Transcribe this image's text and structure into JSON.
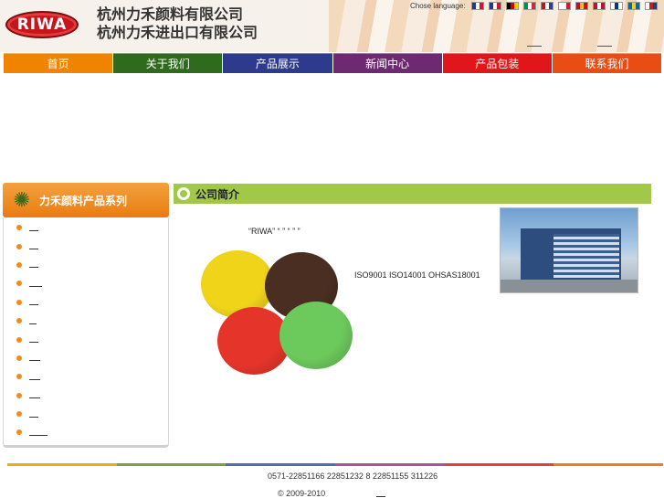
{
  "header": {
    "logo_text": "RIWA",
    "company_line1": "杭州力禾颜料有限公司",
    "company_line2": "杭州力禾进出口有限公司",
    "language_label": "Chose language:",
    "flags": [
      {
        "name": "uk-flag-icon",
        "colors": [
          "#1f3a8a",
          "#ffffff",
          "#cf142b"
        ]
      },
      {
        "name": "france-flag-icon",
        "colors": [
          "#1f3a8a",
          "#ffffff",
          "#cf142b"
        ]
      },
      {
        "name": "germany-flag-icon",
        "colors": [
          "#000000",
          "#dd0000",
          "#ffce00"
        ]
      },
      {
        "name": "italy-flag-icon",
        "colors": [
          "#009246",
          "#ffffff",
          "#ce2b37"
        ]
      },
      {
        "name": "netherlands-flag-icon",
        "colors": [
          "#ae1c28",
          "#ffffff",
          "#21468b"
        ]
      },
      {
        "name": "poland-flag-icon",
        "colors": [
          "#ffffff",
          "#ffffff",
          "#dc143c"
        ]
      },
      {
        "name": "spain-flag-icon",
        "colors": [
          "#c60b1e",
          "#ffc400",
          "#c60b1e"
        ]
      },
      {
        "name": "denmark-flag-icon",
        "colors": [
          "#c60c30",
          "#ffffff",
          "#c60c30"
        ]
      },
      {
        "name": "finland-flag-icon",
        "colors": [
          "#ffffff",
          "#003580",
          "#ffffff"
        ]
      },
      {
        "name": "sweden-flag-icon",
        "colors": [
          "#006aa7",
          "#fecc00",
          "#006aa7"
        ]
      },
      {
        "name": "czech-flag-icon",
        "colors": [
          "#ffffff",
          "#d7141a",
          "#11457e"
        ]
      }
    ]
  },
  "nav": [
    {
      "label": "首页",
      "color": "#f08300"
    },
    {
      "label": "关于我们",
      "color": "#2f6b1d"
    },
    {
      "label": "产品展示",
      "color": "#2e3a8c"
    },
    {
      "label": "新闻中心",
      "color": "#6d2a73"
    },
    {
      "label": "产品包装",
      "color": "#e0161b"
    },
    {
      "label": "联系我们",
      "color": "#ea4d14"
    }
  ],
  "sidebar": {
    "title": "力禾颜料产品系列",
    "items": [
      {
        "label": ""
      },
      {
        "label": ""
      },
      {
        "label": ""
      },
      {
        "label": ""
      },
      {
        "label": ""
      },
      {
        "label": ""
      },
      {
        "label": ""
      },
      {
        "label": ""
      },
      {
        "label": ""
      },
      {
        "label": ""
      },
      {
        "label": ""
      },
      {
        "label": ""
      }
    ]
  },
  "main": {
    "section_title": "公司简介",
    "riwa_text": "“RIWA” “ ” “ ” ”",
    "iso_text": "ISO9001 ISO14001 OHSAS18001",
    "pigment_colors": [
      "#f0d41a",
      "#4b2e22",
      "#e5352a",
      "#6cc95b"
    ]
  },
  "footer": {
    "bar_colors": [
      "#f0a818",
      "#7aa14a",
      "#4e6fab",
      "#b14fa0",
      "#e04040",
      "#f07e20"
    ],
    "contact": "0571-22851166 22851232 8 22851155      311226",
    "copyright": "© 2009-2010"
  }
}
